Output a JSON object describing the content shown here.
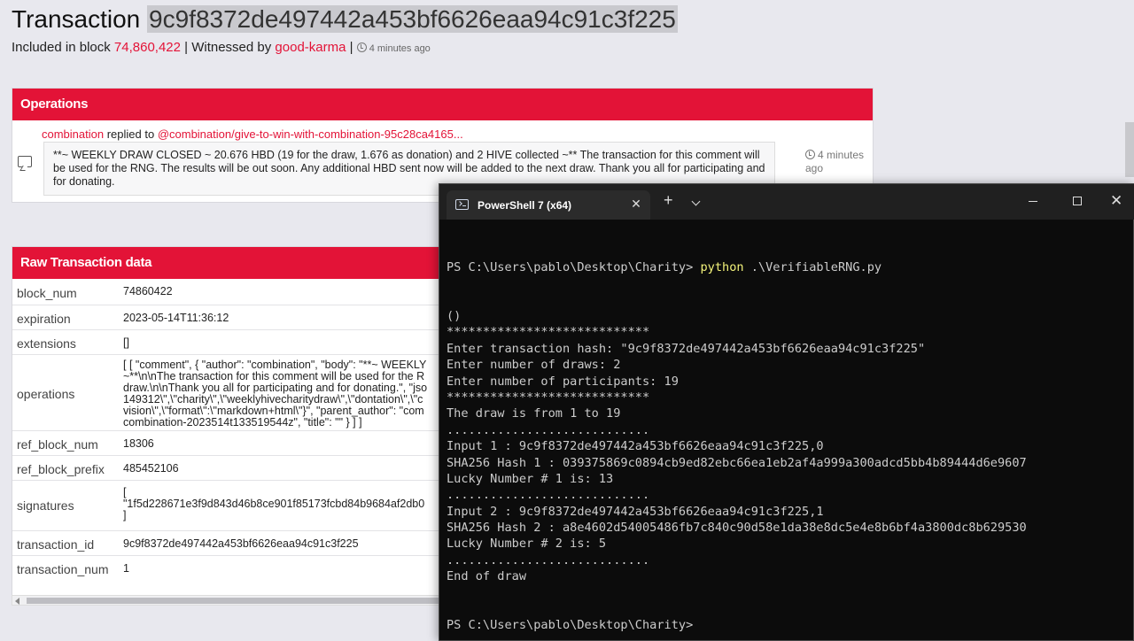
{
  "page": {
    "title_label": "Transaction",
    "title_hash": "9c9f8372de497442a453bf6626eaa94c91c3f225",
    "included_prefix": "Included in block ",
    "block_number": "74,860,422",
    "witnessed_prefix": " | Witnessed by ",
    "witness": "good-karma",
    "sep": " | ",
    "time_ago": "4 minutes ago"
  },
  "operations": {
    "header": "Operations",
    "author": "combination",
    "action": " replied to ",
    "target": "@combination/give-to-win-with-combination-95c28ca4165...",
    "body": "**~ WEEKLY DRAW CLOSED ~ 20.676 HBD (19 for the draw, 1.676 as donation) and 2 HIVE collected ~** The transaction for this comment will be used for the RNG. The results will be out soon. Any additional HBD sent now will be added to the next draw. Thank you all for participating and for donating.",
    "time_ago": "4 minutes ago"
  },
  "raw": {
    "header": "Raw Transaction data",
    "rows": [
      {
        "key": "block_num",
        "value": "74860422"
      },
      {
        "key": "expiration",
        "value": "2023-05-14T11:36:12"
      },
      {
        "key": "extensions",
        "value": "[]"
      },
      {
        "key": "operations",
        "value": "[ [ \"comment\", { \"author\": \"combination\", \"body\": \"**~ WEEKLY ~**\\n\\nThe transaction for this comment will be used for the R draw.\\n\\nThank you all for participating and for donating.\", \"jso 149312\\\",\\\"charity\\\",\\\"weeklyhivecharitydraw\\\",\\\"dontation\\\",\\\"c vision\\\",\\\"format\\\":\\\"markdown+html\\\"}\", \"parent_author\": \"com combination-2023514t133519544z\", \"title\": \"\" } ] ]"
      },
      {
        "key": "ref_block_num",
        "value": "18306"
      },
      {
        "key": "ref_block_prefix",
        "value": "485452106"
      },
      {
        "key": "signatures",
        "value_lines": [
          "[",
          "\"1f5d228671e3f9d843d46b8ce901f85173fcbd84b9684af2db0",
          "]"
        ]
      },
      {
        "key": "transaction_id",
        "value": "9c9f8372de497442a453bf6626eaa94c91c3f225"
      },
      {
        "key": "transaction_num",
        "value": "1"
      }
    ]
  },
  "terminal": {
    "tab_title": "PowerShell 7 (x64)",
    "new_tab": "+",
    "close_symbol": "✕",
    "prompt": "PS C:\\Users\\pablo\\Desktop\\Charity> ",
    "command_name": "python",
    "command_args": " .\\VerifiableRNG.py",
    "lines": [
      "()",
      "****************************",
      "Enter transaction hash: \"9c9f8372de497442a453bf6626eaa94c91c3f225\"",
      "Enter number of draws: 2",
      "Enter number of participants: 19",
      "****************************",
      "The draw is from 1 to 19",
      "............................",
      "Input 1 : 9c9f8372de497442a453bf6626eaa94c91c3f225,0",
      "SHA256 Hash 1 : 039375869c0894cb9ed82ebc66ea1eb2af4a999a300adcd5bb4b89444d6e9607",
      "Lucky Number # 1 is: 13",
      "............................",
      "Input 2 : 9c9f8372de497442a453bf6626eaa94c91c3f225,1",
      "SHA256 Hash 2 : a8e4602d54005486fb7c840c90d58e1da38e8dc5e4e8b6bf4a3800dc8b629530",
      "Lucky Number # 2 is: 5",
      "............................",
      "End of draw"
    ],
    "final_prompt": "PS C:\\Users\\pablo\\Desktop\\Charity>"
  },
  "colors": {
    "accent": "#e31337",
    "terminal_bg": "#0c0c0c",
    "terminal_text": "#cccccc",
    "command_highlight": "#f2f27a"
  }
}
